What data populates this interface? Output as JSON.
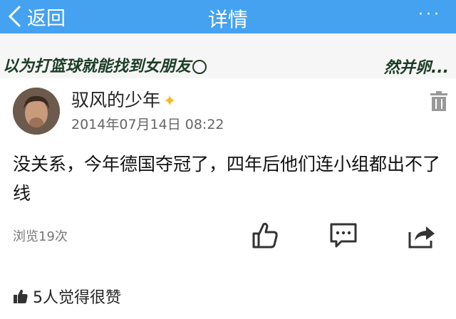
{
  "header": {
    "back_label": "返回",
    "title": "详情",
    "more_label": "···"
  },
  "banner": {
    "left_text": "以为打篮球就能找到女朋友",
    "right_text": "然并卵..."
  },
  "post": {
    "author": "驭风的少年",
    "datetime": "2014年07月14日 08:22",
    "content": "没关系，今年德国夺冠了，四年后他们连小组都出不了线",
    "views": "浏览19次",
    "likes": "5人觉得很赞"
  },
  "colors": {
    "topbar": "#44a2f0",
    "author_badge": "#f1ba28"
  }
}
